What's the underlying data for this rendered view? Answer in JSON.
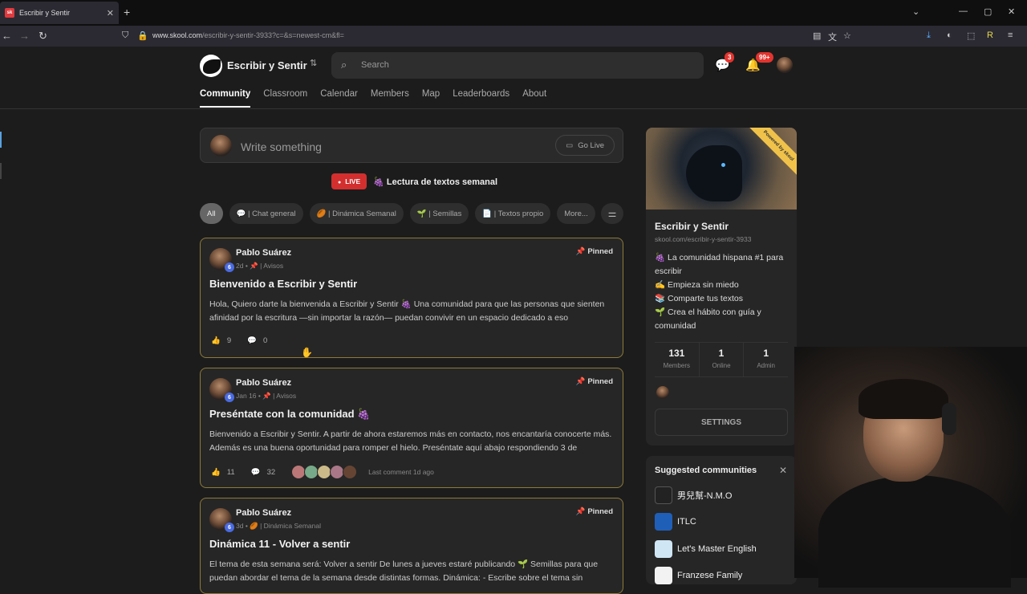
{
  "browser": {
    "tab_title": "Escribir y Sentir",
    "url_domain": "www.skool.com",
    "url_path": "/escribir-y-sentir-3933?c=&s=newest-cm&fl="
  },
  "header": {
    "group_name": "Escribir y Sentir",
    "search_placeholder": "Search",
    "chat_badge": "3",
    "notif_badge": "99+"
  },
  "nav": {
    "tabs": [
      "Community",
      "Classroom",
      "Calendar",
      "Members",
      "Map",
      "Leaderboards",
      "About"
    ]
  },
  "compose": {
    "placeholder": "Write something",
    "go_live": "Go Live"
  },
  "live": {
    "badge": "LIVE",
    "title": "🍇 Lectura de textos semanal"
  },
  "chips": [
    "All",
    "💬 | Chat general",
    "🏉 | Dinámica Semanal",
    "🌱 | Semillas",
    "📄 | Textos propio",
    "More...",
    ""
  ],
  "posts": [
    {
      "author": "Pablo Suárez",
      "level": "6",
      "meta": "2d • 📌 | Avisos",
      "pinned": "Pinned",
      "title": "Bienvenido a Escribir y Sentir",
      "body": "Hola, Quiero darte la bienvenida a Escribir y Sentir 🍇 Una comunidad para que las personas que sienten afinidad por la escritura —sin importar la razón— puedan convivir en un espacio dedicado a eso",
      "likes": "9",
      "comments": "0",
      "last_comment": ""
    },
    {
      "author": "Pablo Suárez",
      "level": "6",
      "meta": "Jan 16 • 📌 | Avisos",
      "pinned": "Pinned",
      "title": "Preséntate con la comunidad 🍇",
      "body": "Bienvenido a Escribir y Sentir. A partir de ahora estaremos más en contacto, nos encantaría conocerte más. Además es una buena oportunidad para romper el hielo. Preséntate aquí abajo respondiendo 3 de",
      "likes": "11",
      "comments": "32",
      "last_comment": "Last comment 1d ago"
    },
    {
      "author": "Pablo Suárez",
      "level": "6",
      "meta": "3d • 🏉 | Dinámica Semanal",
      "pinned": "Pinned",
      "title": "Dinámica 11 - Volver a sentir",
      "body": "El tema de esta semana será: Volver a sentir De lunes a jueves estaré publicando 🌱 Semillas para que puedan abordar el tema de la semana desde distintas formas. Dinámica: - Escribe sobre el tema sin",
      "likes": "",
      "comments": "",
      "last_comment": ""
    }
  ],
  "sidebar": {
    "ribbon": "Powered by skool",
    "name": "Escribir y Sentir",
    "url": "skool.com/escribir-y-sentir-3933",
    "desc": [
      "🍇 La comunidad hispana #1 para escribir",
      "✍️ Empieza sin miedo",
      "📚 Comparte tus textos",
      "🌱 Crea el hábito con guía y comunidad"
    ],
    "stats": [
      {
        "n": "131",
        "l": "Members"
      },
      {
        "n": "1",
        "l": "Online"
      },
      {
        "n": "1",
        "l": "Admin"
      }
    ],
    "settings": "SETTINGS"
  },
  "suggested": {
    "title": "Suggested communities",
    "items": [
      {
        "name": "男兒幫-N.M.O",
        "color": "#222"
      },
      {
        "name": "ITLC",
        "color": "#1f5fb8"
      },
      {
        "name": "Let's Master English",
        "color": "#cfe6f5"
      },
      {
        "name": "Franzese Family",
        "color": "#f2f2f2"
      }
    ]
  }
}
